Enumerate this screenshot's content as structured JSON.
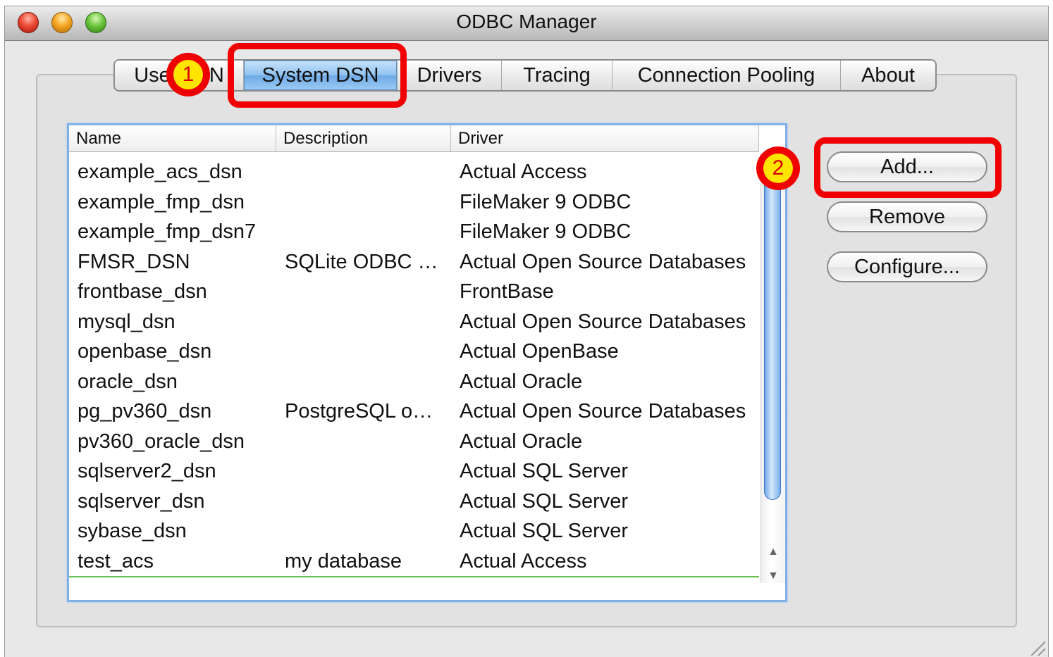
{
  "window": {
    "title": "ODBC Manager"
  },
  "tabs": [
    {
      "label": "Use",
      "label_end": "N"
    },
    {
      "label": "System DSN"
    },
    {
      "label": "Drivers"
    },
    {
      "label": "Tracing"
    },
    {
      "label": "Connection Pooling"
    },
    {
      "label": "About"
    }
  ],
  "selected_tab": "System DSN",
  "table": {
    "columns": [
      "Name",
      "Description",
      "Driver"
    ],
    "rows": [
      {
        "name": "example_acs_dsn",
        "description": "",
        "driver": "Actual Access"
      },
      {
        "name": "example_fmp_dsn",
        "description": "",
        "driver": "FileMaker 9 ODBC"
      },
      {
        "name": "example_fmp_dsn7",
        "description": "",
        "driver": "FileMaker 9 ODBC"
      },
      {
        "name": "FMSR_DSN",
        "description": "SQLite ODBC …",
        "driver": "Actual Open Source Databases"
      },
      {
        "name": "frontbase_dsn",
        "description": "",
        "driver": "FrontBase"
      },
      {
        "name": "mysql_dsn",
        "description": "",
        "driver": "Actual Open Source Databases"
      },
      {
        "name": "openbase_dsn",
        "description": "",
        "driver": "Actual OpenBase"
      },
      {
        "name": "oracle_dsn",
        "description": "",
        "driver": "Actual Oracle"
      },
      {
        "name": "pg_pv360_dsn",
        "description": "PostgreSQL o…",
        "driver": "Actual Open Source Databases"
      },
      {
        "name": "pv360_oracle_dsn",
        "description": "",
        "driver": "Actual Oracle"
      },
      {
        "name": "sqlserver2_dsn",
        "description": "",
        "driver": "Actual SQL Server"
      },
      {
        "name": "sqlserver_dsn",
        "description": "",
        "driver": "Actual SQL Server"
      },
      {
        "name": "sybase_dsn",
        "description": "",
        "driver": "Actual SQL Server"
      },
      {
        "name": "test_acs",
        "description": "my database",
        "driver": "Actual Access"
      }
    ]
  },
  "buttons": {
    "add": "Add...",
    "remove": "Remove",
    "configure": "Configure..."
  },
  "annotations": {
    "step1": "1",
    "step2": "2",
    "highlight_color": "#f00000",
    "marker_fill": "#ffe400"
  },
  "scrollbar": {
    "up_arrow": "▲",
    "down_arrow": "▼"
  }
}
